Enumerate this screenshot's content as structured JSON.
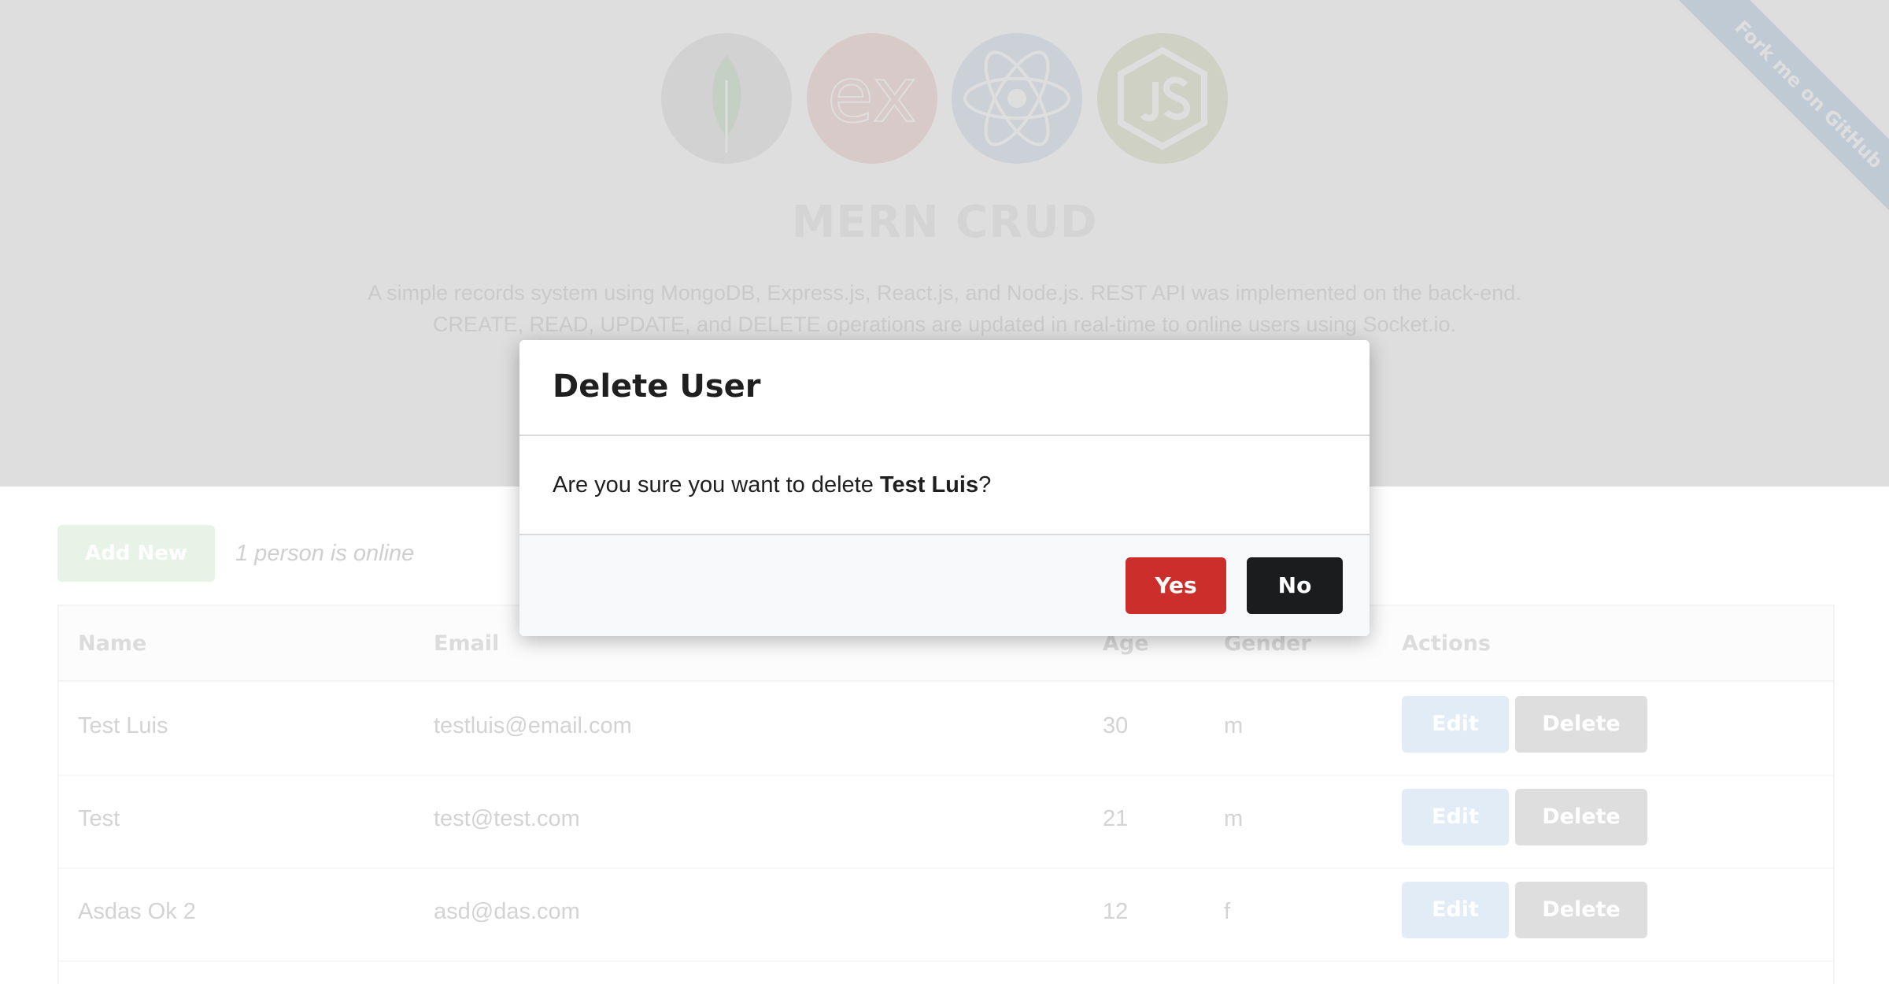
{
  "hero": {
    "title": "MERN CRUD",
    "description_line1": "A simple records system using MongoDB, Express.js, React.js, and Node.js. REST API was implemented on the back-end.",
    "description_line2": "CREATE, READ, UPDATE, and DELETE operations are updated in real-time to online users using Socket.io.",
    "logos": [
      "mongodb-icon",
      "express-icon",
      "react-icon",
      "nodejs-icon"
    ],
    "express_logo_text": "ex"
  },
  "ribbon": {
    "label": "Fork me on GitHub"
  },
  "toolbar": {
    "add_label": "Add New",
    "online_text": "1 person is online"
  },
  "table": {
    "headers": [
      "Name",
      "Email",
      "Age",
      "Gender",
      "Actions"
    ],
    "rows": [
      {
        "name": "Test Luis",
        "email": "testluis@email.com",
        "age": "30",
        "gender": "m"
      },
      {
        "name": "Test",
        "email": "test@test.com",
        "age": "21",
        "gender": "m"
      },
      {
        "name": "Asdas Ok 2",
        "email": "asd@das.com",
        "age": "12",
        "gender": "f"
      }
    ],
    "edit_label": "Edit",
    "delete_label": "Delete"
  },
  "modal": {
    "title": "Delete User",
    "message_prefix": "Are you sure you want to delete ",
    "target_name": "Test Luis",
    "message_suffix": "?",
    "yes_label": "Yes",
    "no_label": "No"
  },
  "colors": {
    "yes_button": "#cb2e2b",
    "no_button": "#1b1c1d",
    "overlay": "#dedede"
  }
}
